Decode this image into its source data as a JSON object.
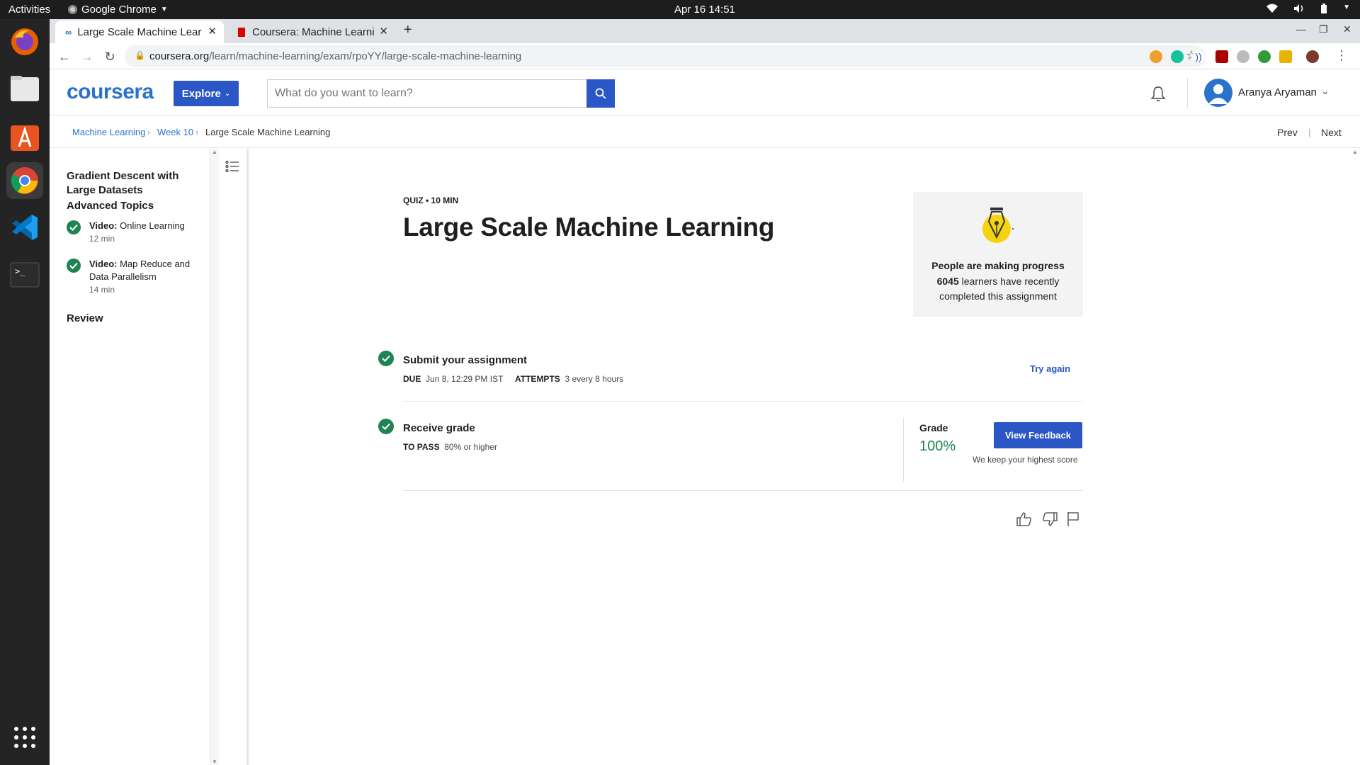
{
  "system": {
    "activities": "Activities",
    "app_name": "Google Chrome",
    "datetime": "Apr 16  14:51"
  },
  "dock": [
    "firefox-icon",
    "files-icon",
    "software-icon",
    "chrome-icon",
    "vscode-icon",
    "terminal-icon",
    "apps-grid-icon"
  ],
  "browser": {
    "tabs": [
      {
        "title": "Large Scale Machine Lear",
        "active": true
      },
      {
        "title": "Coursera: Machine Learni",
        "active": false
      }
    ],
    "url": "coursera.org/learn/machine-learning/exam/rpoYY/large-scale-machine-learning",
    "url_domain": "coursera.org",
    "url_path": "/learn/machine-learning/exam/rpoYY/large-scale-machine-learning"
  },
  "header": {
    "logo": "coursera",
    "explore": "Explore",
    "search_placeholder": "What do you want to learn?",
    "user_name": "Aranya Aryaman"
  },
  "breadcrumb": {
    "items": [
      "Machine Learning",
      "Week 10",
      "Large Scale Machine Learning"
    ],
    "prev": "Prev",
    "next": "Next"
  },
  "sidebar": {
    "section1": "Gradient Descent with Large Datasets",
    "section2": "Advanced Topics",
    "items": [
      {
        "type": "Video:",
        "title": "Online Learning",
        "duration": "12 min"
      },
      {
        "type": "Video:",
        "title_line1": "Map Reduce and",
        "title_line2": "Data Parallelism",
        "duration": "14 min"
      }
    ],
    "section3": "Review"
  },
  "quiz": {
    "kicker": "QUIZ • 10 MIN",
    "title": "Large Scale Machine Learning",
    "progress_heading": "People are making progress",
    "progress_count": "6045",
    "progress_text_1": " learners have recently",
    "progress_text_2": "completed this assignment",
    "submit": {
      "heading": "Submit your assignment",
      "due_label": "DUE",
      "due_value": "Jun 8, 12:29 PM IST",
      "attempts_label": "ATTEMPTS",
      "attempts_value": "3 every 8 hours",
      "action": "Try again"
    },
    "grade": {
      "heading": "Receive grade",
      "pass_label": "TO PASS",
      "pass_value": "80% or higher",
      "grade_label": "Grade",
      "grade_value": "100%",
      "button": "View Feedback",
      "note": "We keep your highest score"
    }
  },
  "colors": {
    "accent": "#2a56c6",
    "success": "#1f8354",
    "logo": "#2a73cc"
  }
}
